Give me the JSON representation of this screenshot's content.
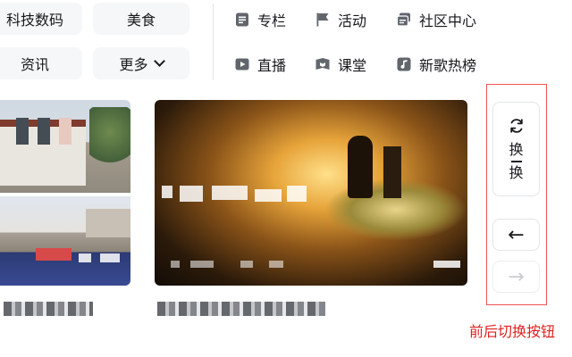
{
  "categories": {
    "chips": [
      {
        "label": "科技数码"
      },
      {
        "label": "美食"
      },
      {
        "label": "资讯"
      },
      {
        "label": "更多"
      }
    ],
    "links": [
      {
        "label": "专栏",
        "icon": "document-icon"
      },
      {
        "label": "活动",
        "icon": "flag-icon"
      },
      {
        "label": "社区中心",
        "icon": "community-icon"
      },
      {
        "label": "直播",
        "icon": "live-icon"
      },
      {
        "label": "课堂",
        "icon": "classroom-icon"
      },
      {
        "label": "新歌热榜",
        "icon": "music-icon"
      }
    ]
  },
  "controls": {
    "refresh_label_top": "换",
    "refresh_label_bottom": "换",
    "prev_arrow": "←",
    "next_arrow": "→",
    "annotation": "前后切换按钮"
  },
  "colors": {
    "annotation": "#e22020",
    "chip_bg": "#f6f7f8",
    "border": "#e3e5e7"
  }
}
